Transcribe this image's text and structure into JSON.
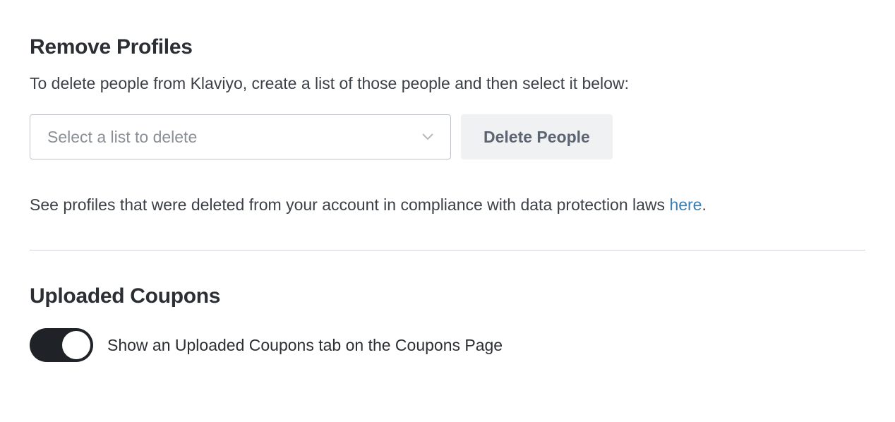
{
  "removeProfiles": {
    "title": "Remove Profiles",
    "description": "To delete people from Klaviyo, create a list of those people and then select it below:",
    "selectPlaceholder": "Select a list to delete",
    "deleteButton": "Delete People",
    "infoPrefix": "See profiles that were deleted from your account in compliance with data protection laws ",
    "infoLink": "here",
    "infoSuffix": "."
  },
  "uploadedCoupons": {
    "title": "Uploaded Coupons",
    "toggleLabel": "Show an Uploaded Coupons tab on the Coupons Page",
    "toggleState": true
  }
}
